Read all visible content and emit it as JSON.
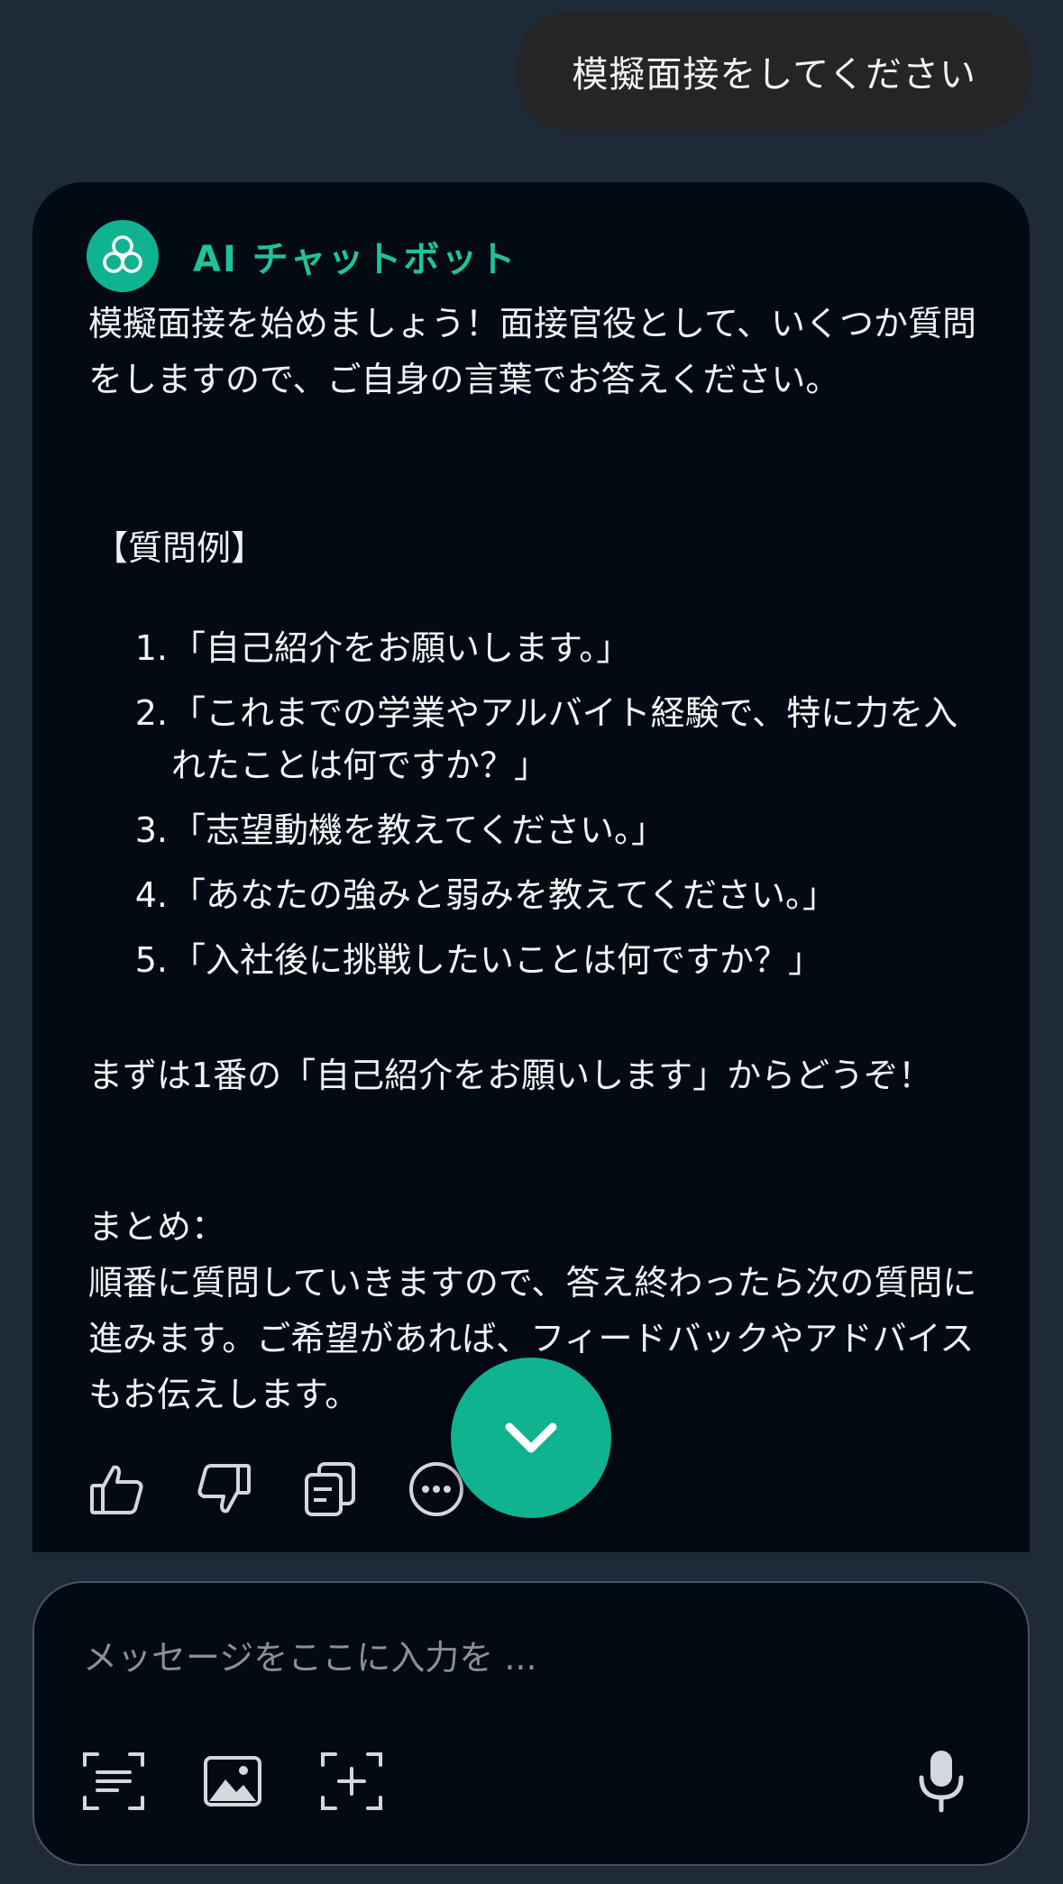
{
  "user_message": {
    "text": "模擬面接をしてください"
  },
  "bot": {
    "name": "AI チャットボット",
    "intro": "模擬面接を始めましょう！面接官役として、いくつか質問をしますので、ご自身の言葉でお答えください。",
    "section_heading": "【質問例】",
    "questions": [
      {
        "num": "1.",
        "text": "「自己紹介をお願いします。」"
      },
      {
        "num": "2.",
        "text": "「これまでの学業やアルバイト経験で、特に力を入れたことは何ですか？」"
      },
      {
        "num": "3.",
        "text": "「志望動機を教えてください。」"
      },
      {
        "num": "4.",
        "text": "「あなたの強みと弱みを教えてください。」"
      },
      {
        "num": "5.",
        "text": "「入社後に挑戦したいことは何ですか？」"
      }
    ],
    "prompt": "まずは1番の「自己紹介をお願いします」からどうぞ！",
    "summary_label": "まとめ：",
    "summary_text": "順番に質問していきますので、答え終わったら次の質問に進みます。ご希望があれば、フィードバックやアドバイスもお伝えします。"
  },
  "actions": {
    "icons": [
      "thumbs-up-icon",
      "thumbs-down-icon",
      "copy-icon",
      "more-icon"
    ]
  },
  "composer": {
    "placeholder": "メッセージをここに入力を ...",
    "tools": [
      "scan-text-icon",
      "image-icon",
      "add-frame-icon"
    ],
    "mic": "microphone-icon"
  },
  "colors": {
    "background": "#1f2a38",
    "card": "#040a14",
    "accent": "#10b38f",
    "bot_name": "#1ec39b",
    "user_bubble": "#252526"
  }
}
